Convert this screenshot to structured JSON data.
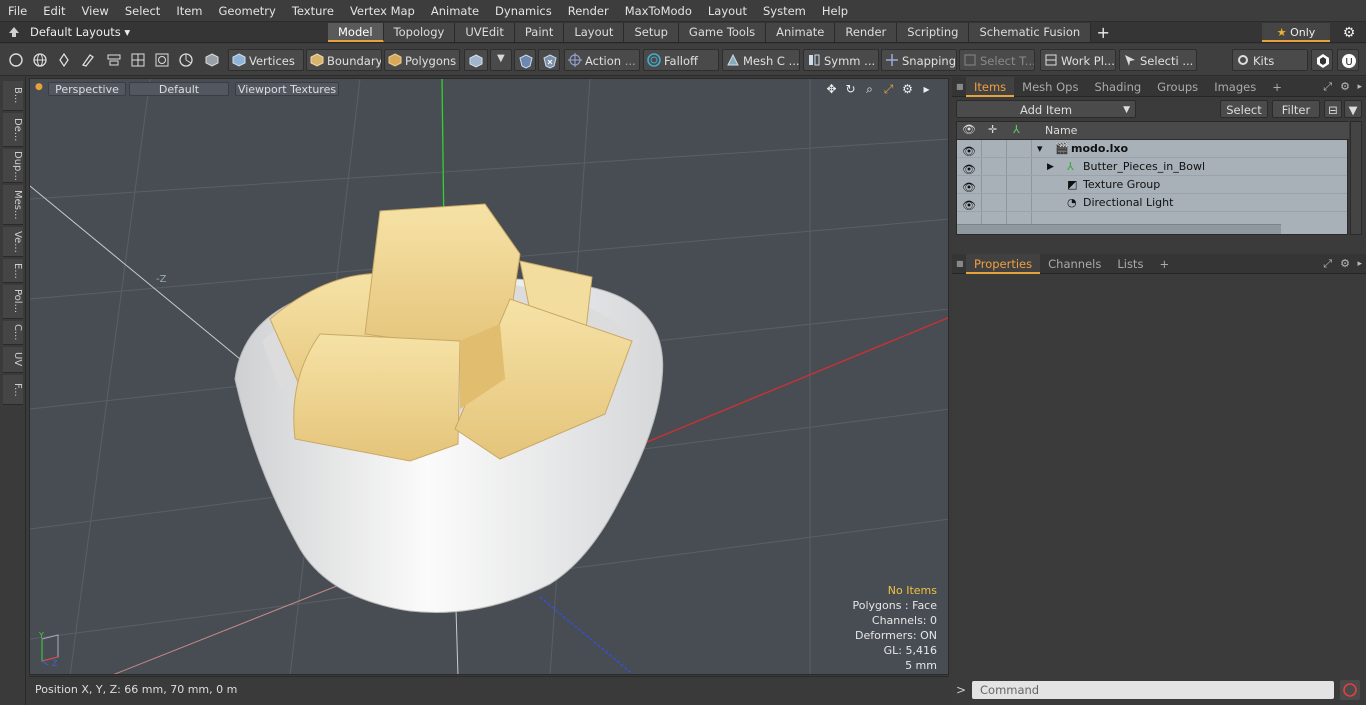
{
  "menu": [
    "File",
    "Edit",
    "View",
    "Select",
    "Item",
    "Geometry",
    "Texture",
    "Vertex Map",
    "Animate",
    "Dynamics",
    "Render",
    "MaxToModo",
    "Layout",
    "System",
    "Help"
  ],
  "layouts_label": "Default Layouts",
  "tabs": [
    {
      "label": "Model",
      "active": true
    },
    {
      "label": "Topology"
    },
    {
      "label": "UVEdit"
    },
    {
      "label": "Paint"
    },
    {
      "label": "Layout"
    },
    {
      "label": "Setup"
    },
    {
      "label": "Game Tools"
    },
    {
      "label": "Animate"
    },
    {
      "label": "Render"
    },
    {
      "label": "Scripting"
    },
    {
      "label": "Schematic Fusion"
    }
  ],
  "only_label": "Only",
  "toolbar": {
    "vertices": "Vertices",
    "boundary": "Boundary",
    "polygons": "Polygons",
    "action": "Action",
    "falloff": "Falloff",
    "mesh_c": "Mesh C ...",
    "symm": "Symm ...",
    "snapping": "Snapping",
    "select_t": "Select T...",
    "work_pl": "Work Pl...",
    "selecti": "Selecti ...",
    "kits": "Kits"
  },
  "leftstrip": [
    "B...",
    "De...",
    "Dup...",
    "Mes...",
    "Ve...",
    "E...",
    "Pol...",
    "C...",
    "UV",
    "F..."
  ],
  "viewport": {
    "perspective": "Perspective",
    "default": "Default",
    "viewport_textures": "Viewport Textures",
    "axis_label": "-Z",
    "info": {
      "no_items": "No Items",
      "polygons": "Polygons : Face",
      "channels": "Channels: 0",
      "deformers": "Deformers: ON",
      "gl": "GL: 5,416",
      "scale": "5 mm"
    }
  },
  "status": "Position X, Y, Z:  66 mm, 70 mm, 0 m",
  "items_panel": {
    "tabs": [
      "Items",
      "Mesh Ops",
      "Shading",
      "Groups",
      "Images"
    ],
    "add_item": "Add Item",
    "select": "Select",
    "filter": "Filter",
    "name_header": "Name",
    "rows": [
      {
        "label": "modo.lxo",
        "bold": true,
        "indent": 0
      },
      {
        "label": "Butter_Pieces_in_Bowl",
        "indent": 1
      },
      {
        "label": "Texture Group",
        "indent": 1
      },
      {
        "label": "Directional Light",
        "indent": 1
      }
    ]
  },
  "props_panel": {
    "tabs": [
      "Properties",
      "Channels",
      "Lists"
    ]
  },
  "command": {
    "prompt": ">",
    "placeholder": "Command"
  },
  "colors": {
    "accent": "#e8a23a",
    "viewport_bg": "#484d54",
    "list_bg": "#a7b1b7",
    "butter": "#f0d898",
    "bowl": "#f4f4f4"
  }
}
